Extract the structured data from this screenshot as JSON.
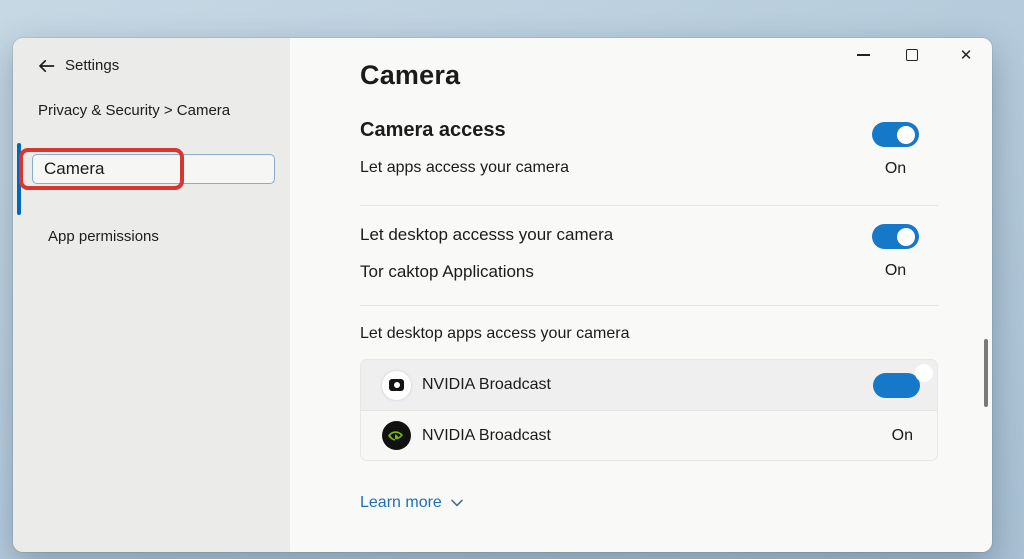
{
  "colors": {
    "accent": "#1678c9",
    "accent_bar": "#0067c0",
    "link": "#1d6fb8",
    "annotation": "#d9362f",
    "scrollbar": "#7a7a7a",
    "nvidia_green": "#76b900"
  },
  "icons": {
    "back": "back-arrow",
    "minimize": "minimize",
    "maximize": "maximize",
    "close": "close",
    "close_glyph": "✕",
    "chevron_down": "chevron-down",
    "camera_app": "camera-app",
    "nvidia": "nvidia-logo"
  },
  "sidebar": {
    "title": "Settings",
    "breadcrumb": "Privacy & Security > Camera",
    "search_input": {
      "value": "Camera"
    },
    "items": [
      {
        "label": "App permissions"
      }
    ]
  },
  "main": {
    "page_title": "Camera",
    "sections": [
      {
        "title": "Camera access",
        "description": "Let apps access your camera",
        "toggle_state": "On",
        "toggle_on": true
      },
      {
        "title": "Let desktop accesss your camera",
        "description": "Tor caktop Applications",
        "toggle_state": "On",
        "toggle_on": true
      }
    ],
    "app_permissions": {
      "label": "Let desktop apps access your camera",
      "rows": [
        {
          "app_name": "NVIDIA Broadcast",
          "control": "toggle",
          "toggle_on": true
        },
        {
          "app_name": "NVIDIA Broadcast",
          "state_label": "On"
        }
      ]
    },
    "learn_more_label": "Learn more"
  }
}
